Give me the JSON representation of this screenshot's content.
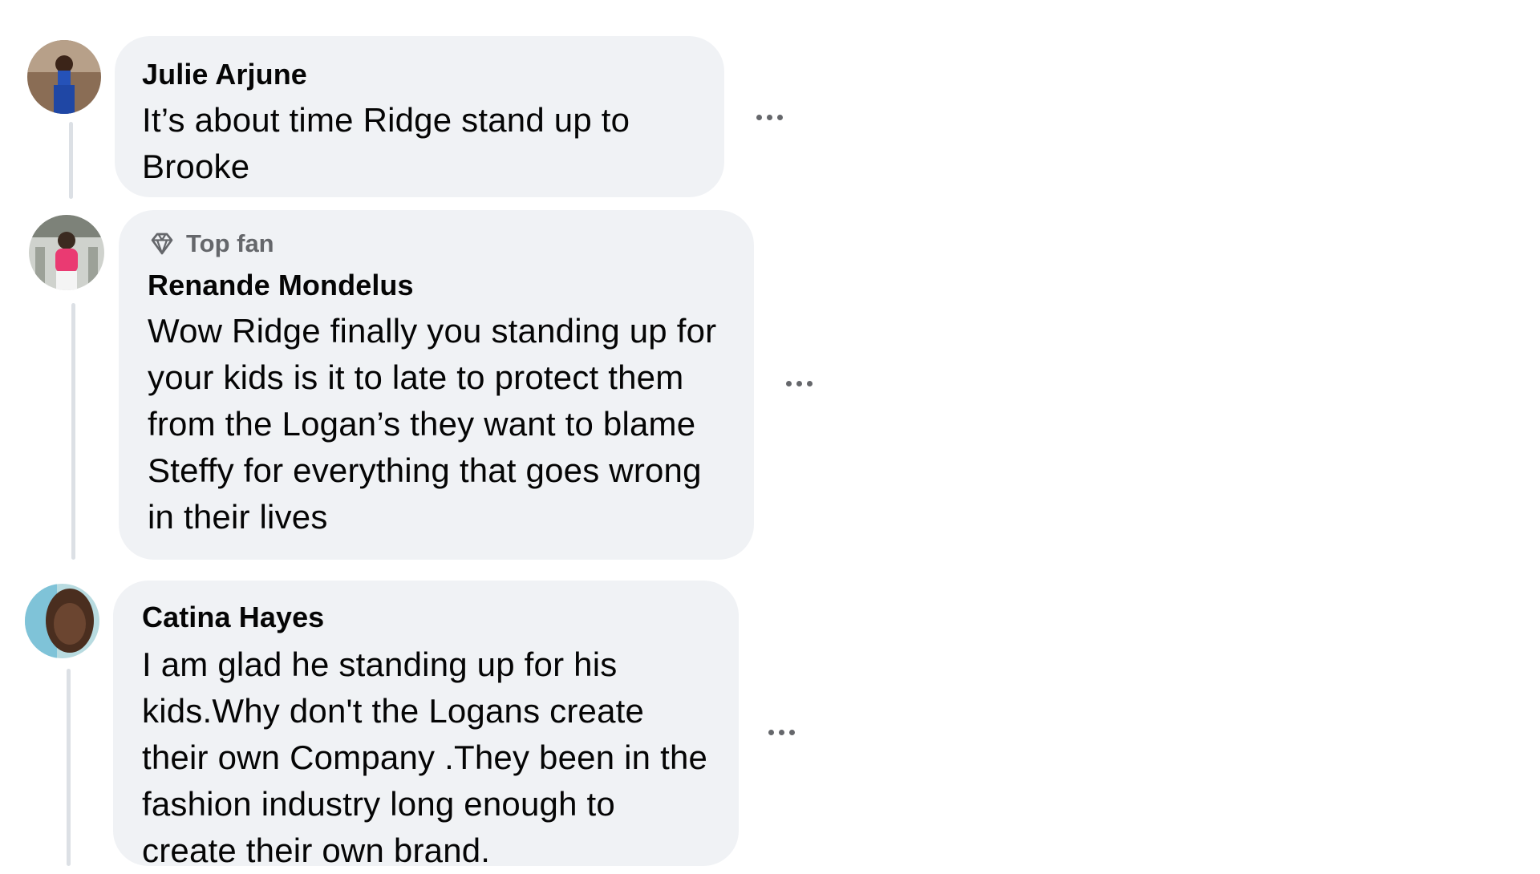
{
  "comments": [
    {
      "author": "Julie Arjune",
      "text": "It’s about time Ridge stand up to Brooke"
    },
    {
      "badge": "Top fan",
      "author": "Renande Mondelus",
      "text": "Wow Ridge finally you standing up for your kids is it to late to protect them from the Logan’s they want to blame Steffy for everything that goes wrong in their lives"
    },
    {
      "author": "Catina Hayes",
      "text": "I am glad he standing up for his kids.Why don't the Logans create their own Company .They been in the fashion industry long enough to create their own brand."
    }
  ],
  "icons": {
    "more": "more-options-icon",
    "badge": "diamond-icon"
  },
  "colors": {
    "bubble": "#f0f2f5",
    "secondary_text": "#65676b",
    "thread_line": "#dce0e5"
  }
}
